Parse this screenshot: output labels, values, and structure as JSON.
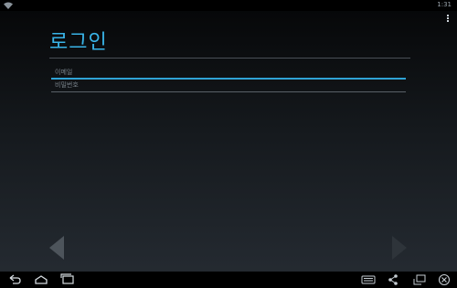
{
  "status_bar": {
    "time": "1:31",
    "wifi_icon": "wifi-icon"
  },
  "login": {
    "title": "로그인",
    "email": {
      "placeholder": "이메일",
      "value": ""
    },
    "password": {
      "placeholder": "비밀번호",
      "value": ""
    }
  },
  "navigation": {
    "prev_icon": "chevron-left-icon",
    "next_icon": "chevron-right-icon"
  },
  "system_bar": {
    "icons": [
      "back-icon",
      "home-icon",
      "recent-apps-icon",
      "keyboard-icon",
      "share-icon",
      "screen-rotate-icon",
      "close-icon"
    ]
  },
  "colors": {
    "accent": "#39b4e8",
    "focus_underline": "#2fa3d6",
    "background_top": "#050607",
    "background_bottom": "#262c33"
  }
}
